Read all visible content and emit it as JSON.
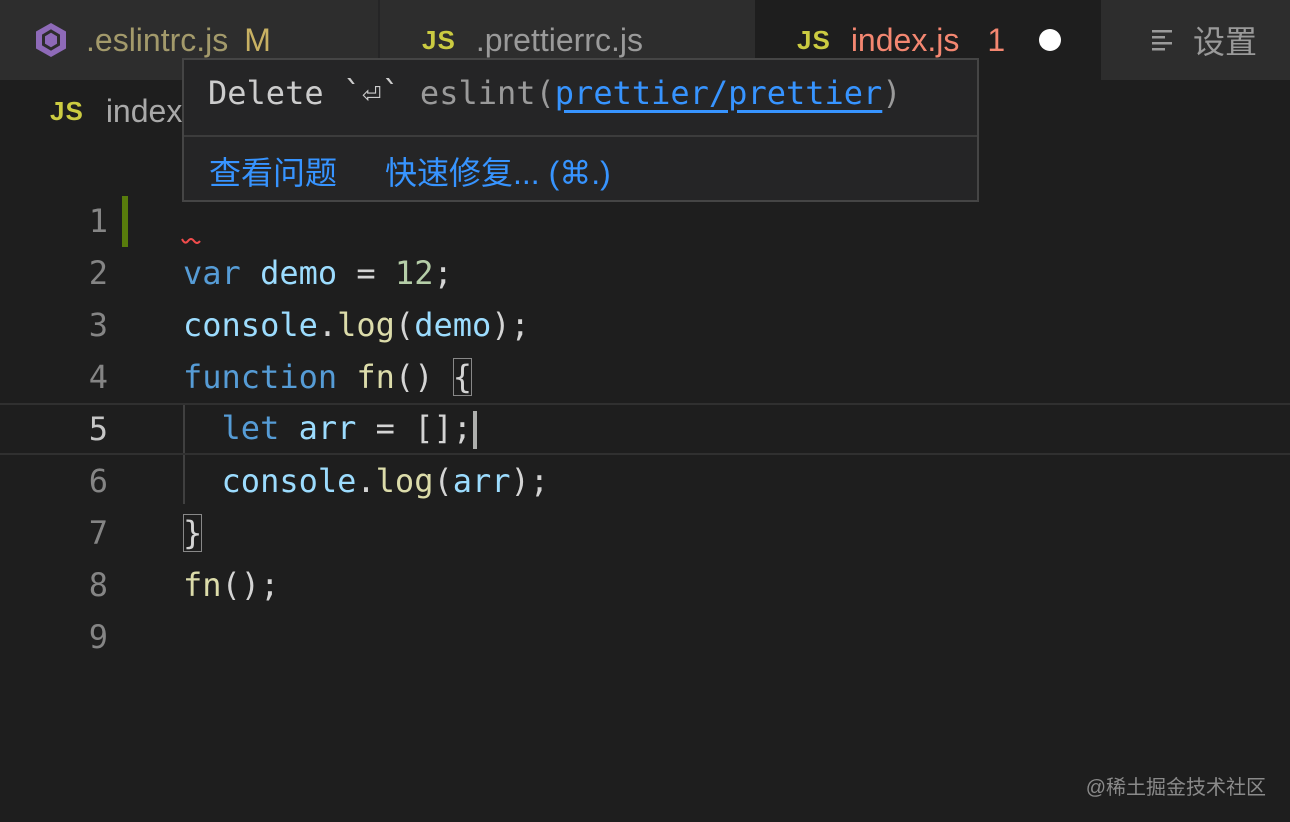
{
  "tabs": [
    {
      "icon": "eslint-hexagon-icon",
      "label": ".eslintrc.js",
      "badge": "M"
    },
    {
      "icon": "js-file-icon",
      "icon_text": "JS",
      "label": ".prettierrc.js"
    },
    {
      "icon": "js-file-icon",
      "icon_text": "JS",
      "label": "index.js",
      "problem_count": "1",
      "dirty": true,
      "active": true
    },
    {
      "icon": "settings-lines-icon",
      "label": "设置"
    }
  ],
  "breadcrumb": {
    "icon_text": "JS",
    "label": "index.js"
  },
  "hover": {
    "message_prefix": "Delete `⏎` ",
    "source": "eslint(",
    "rule_link": "prettier/prettier",
    "source_close": ")",
    "actions": {
      "view_problem": "查看问题",
      "quick_fix": "快速修复... (⌘.)"
    }
  },
  "editor": {
    "line_numbers": [
      "1",
      "2",
      "3",
      "4",
      "5",
      "6",
      "7",
      "8",
      "9"
    ],
    "current_line": "5"
  },
  "code": {
    "l2": {
      "kw": "var",
      "name": "demo",
      "eq": " = ",
      "num": "12",
      "end": ";"
    },
    "l3": {
      "obj": "console",
      "dot": ".",
      "fn": "log",
      "open": "(",
      "arg": "demo",
      "close": ");"
    },
    "l4": {
      "kw": "function",
      "fn": "fn",
      "parens": "() ",
      "brace": "{"
    },
    "l5": {
      "kw": "let",
      "name": "arr",
      "eq": " = ",
      "val": "[];"
    },
    "l6": {
      "obj": "console",
      "dot": ".",
      "fn": "log",
      "open": "(",
      "arg": "arr",
      "close": ");"
    },
    "l7": {
      "brace": "}"
    },
    "l8": {
      "fn": "fn",
      "rest": "();"
    }
  },
  "watermark": "@稀土掘金技术社区",
  "colors": {
    "background": "#1e1e1e",
    "keyword": "#569cd6",
    "variable": "#9cdcfe",
    "function": "#dcdcaa",
    "number": "#b5cea8",
    "error": "#f48771",
    "link": "#3794ff",
    "git_modified": "#587c0c"
  }
}
